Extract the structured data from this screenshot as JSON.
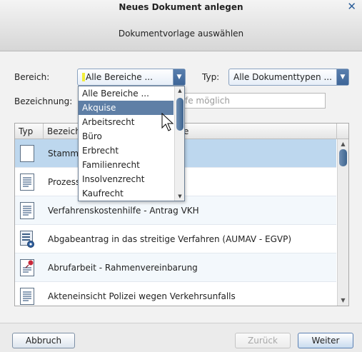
{
  "dialog": {
    "title": "Neues Dokument anlegen",
    "subtitle": "Dokumentvorlage auswählen"
  },
  "filters": {
    "bereich_label": "Bereich:",
    "bereich_value": "Alle Bereiche ...",
    "typ_label": "Typ:",
    "typ_value": "Alle Dokumenttypen ...",
    "bezeichnung_label": "Bezeichnung:",
    "bezeichnung_placeholder_visible": "fe möglich"
  },
  "dropdown": {
    "items": [
      "Alle Bereiche ...",
      "Akquise",
      "Arbeitsrecht",
      "Büro",
      "Erbrecht",
      "Familienrecht",
      "Insolvenzrecht",
      "Kaufrecht"
    ],
    "selected_index": 1
  },
  "table": {
    "columns": [
      "Typ",
      "Bezeich",
      "e"
    ],
    "rows": [
      {
        "name": "Stamml",
        "icon": "blank-document-icon",
        "selected": true
      },
      {
        "name": "Prozess",
        "icon": "text-document-icon",
        "selected": false
      },
      {
        "name": "Verfahrenskostenhilfe - Antrag VKH",
        "icon": "text-document-icon",
        "selected": false
      },
      {
        "name": "Abgabeantrag in das streitige Verfahren (AUMAV - EGVP)",
        "icon": "form-gear-document-icon",
        "selected": false
      },
      {
        "name": "Abrufarbeit - Rahmenvereinbarung",
        "icon": "document-pin-icon",
        "selected": false
      },
      {
        "name": "Akteneinsicht Polizei wegen Verkehrsunfalls",
        "icon": "text-document-icon",
        "selected": false
      }
    ]
  },
  "buttons": {
    "cancel": "Abbruch",
    "back": "Zurück",
    "next": "Weiter"
  },
  "colors": {
    "accent": "#3d6598",
    "selected_row": "#bdd7ee",
    "dropdown_selected": "#5f7fa6"
  }
}
